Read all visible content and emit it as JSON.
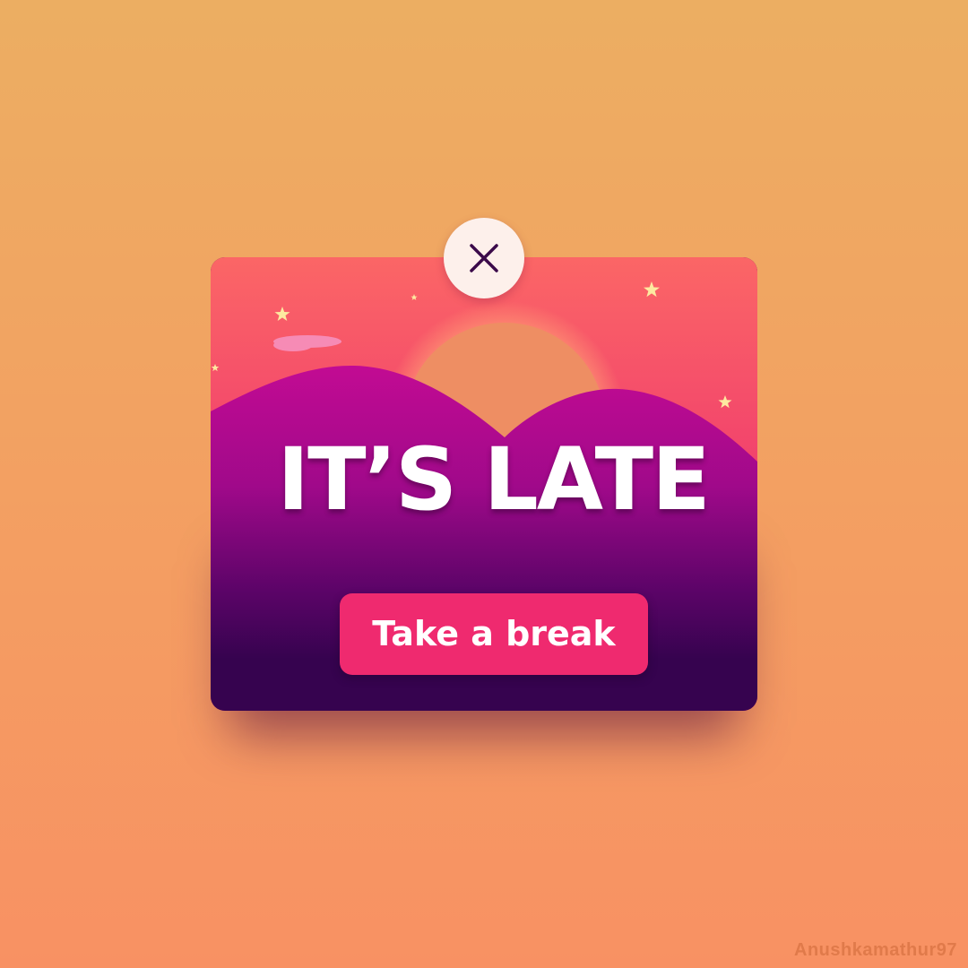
{
  "dialog": {
    "headline": "IT’S LATE",
    "cta_label": "Take a break",
    "close_icon": "close-icon"
  },
  "decorations": {
    "stars_icon": "star-icon",
    "moon_icon": "sun-icon",
    "cloud_icon": "cloud-icon"
  },
  "watermark": "Anushkamathur97",
  "colors": {
    "background_top": "#ecae62",
    "background_bottom": "#f89163",
    "sky_top": "#fb6666",
    "sky_bottom": "#ed2a72",
    "hills": "#b6088f",
    "night": "#36034f",
    "button": "#ef2a6f",
    "close_button": "#fdf0eb",
    "close_x": "#3b0a4a"
  }
}
